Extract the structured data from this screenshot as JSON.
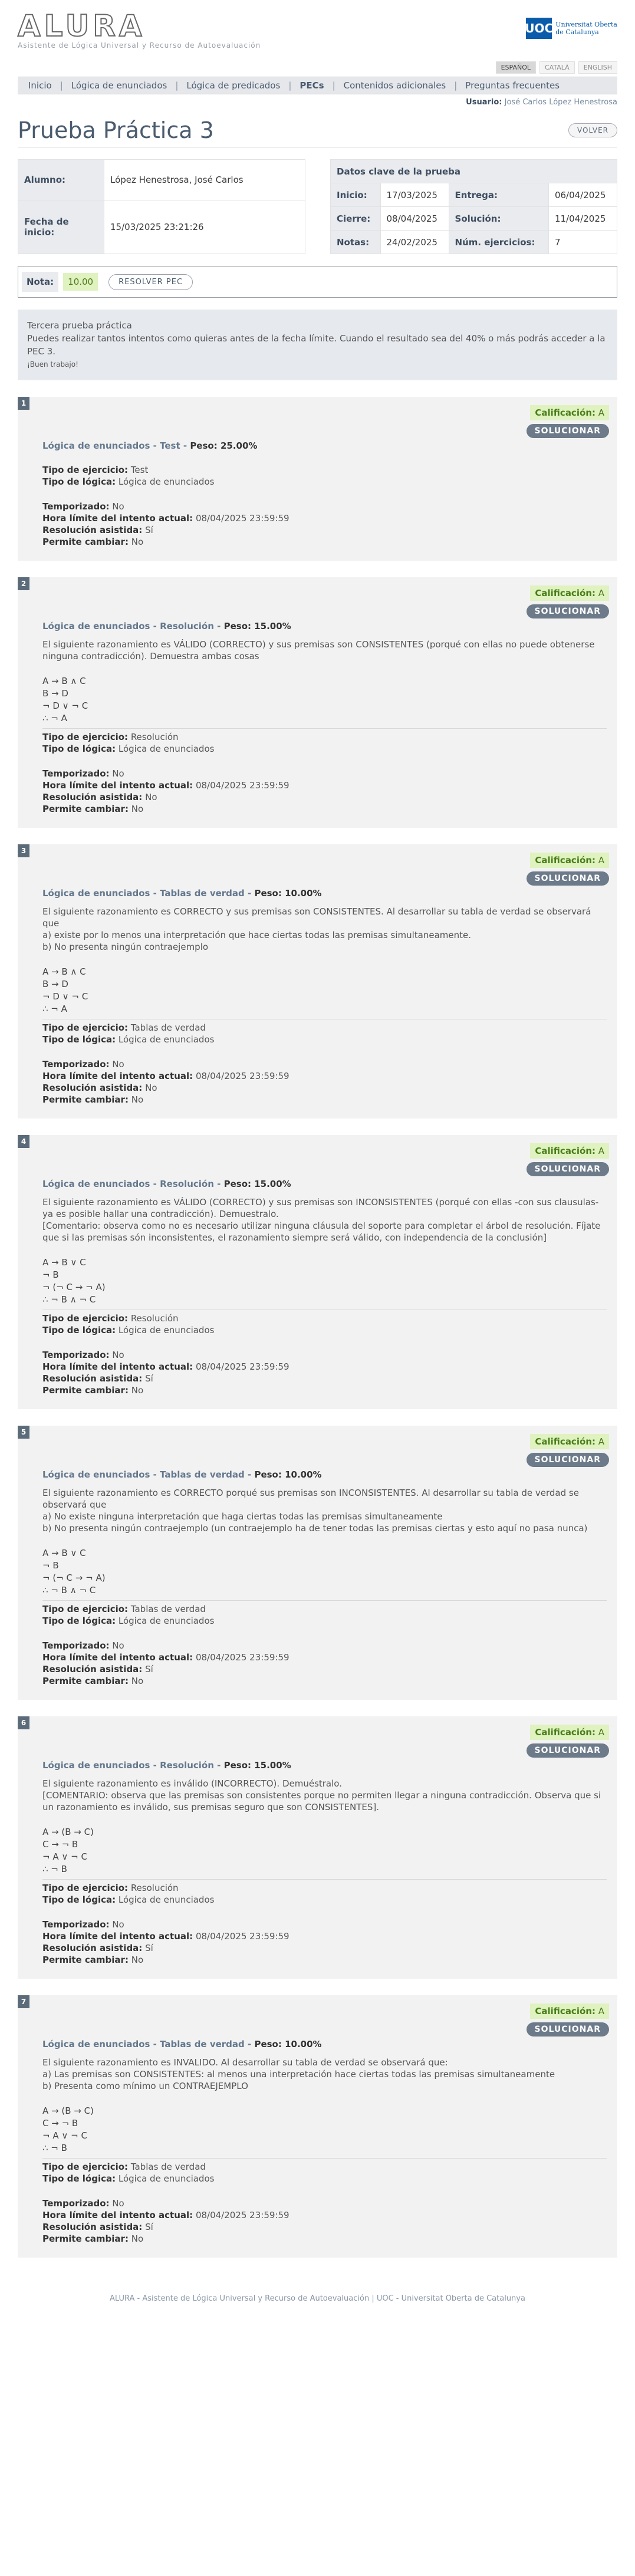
{
  "header": {
    "logo_word": "ALURA",
    "logo_sub": "Asistente de Lógica Universal y Recurso de Autoevaluación",
    "uoc_mark": "UOC",
    "uoc_text_1": "Universitat Oberta",
    "uoc_text_2": "de Catalunya",
    "languages": [
      "ESPAÑOL",
      "CATALÀ",
      "ENGLISH"
    ]
  },
  "nav": {
    "items": [
      "Inicio",
      "Lógica de enunciados",
      "Lógica de predicados",
      "PECs",
      "Contenidos adicionales",
      "Preguntas frecuentes"
    ],
    "active": "PECs"
  },
  "user": {
    "label": "Usuario:",
    "name": "José Carlos López Henestrosa"
  },
  "page": {
    "title": "Prueba Práctica 3",
    "back_button": "VOLVER"
  },
  "student": {
    "alumno_label": "Alumno:",
    "alumno": "López Henestrosa, José Carlos",
    "inicio_label": "Fecha de inicio:",
    "inicio": "15/03/2025 23:21:26"
  },
  "key_data": {
    "title": "Datos clave de la prueba",
    "inicio_label": "Inicio:",
    "inicio": "17/03/2025",
    "entrega_label": "Entrega:",
    "entrega": "06/04/2025",
    "cierre_label": "Cierre:",
    "cierre": "08/04/2025",
    "solucion_label": "Solución:",
    "solucion": "11/04/2025",
    "notas_label": "Notas:",
    "notas": "24/02/2025",
    "num_label": "Núm. ejercicios:",
    "num": "7"
  },
  "grade": {
    "label": "Nota:",
    "value": "10.00",
    "resolve_button": "RESOLVER PEC"
  },
  "description": {
    "line1": "Tercera prueba práctica",
    "line2": "Puedes realizar tantos intentos como quieras antes de la fecha límite. Cuando el resultado sea del 40% o más podrás acceder a la PEC 3.",
    "line3": "¡Buen trabajo!"
  },
  "labels": {
    "calificacion": "Calificación:",
    "solucionar": "SOLUCIONAR",
    "tipo_ejercicio": "Tipo de ejercicio:",
    "tipo_logica": "Tipo de lógica:",
    "temporizado": "Temporizado:",
    "hora_limite": "Hora límite del intento actual:",
    "resolucion": "Resolución asistida:",
    "permite": "Permite cambiar:",
    "peso": "Peso:"
  },
  "exercises": [
    {
      "num": "1",
      "grade": "A",
      "area": "Lógica de enunciados",
      "kind": "Test",
      "peso": "25.00%",
      "statement": [],
      "premises": [],
      "tipo_ejercicio": "Test",
      "tipo_logica": "Lógica de enunciados",
      "temporizado": "No",
      "hora_limite": "08/04/2025 23:59:59",
      "resolucion": "Sí",
      "permite": "No"
    },
    {
      "num": "2",
      "grade": "A",
      "area": "Lógica de enunciados",
      "kind": "Resolución",
      "peso": "15.00%",
      "statement": [
        "El siguiente razonamiento es VÁLIDO (CORRECTO) y sus premisas son CONSISTENTES (porqué con ellas no puede obtenerse ninguna contradicción). Demuestra ambas cosas"
      ],
      "premises": [
        "A → B ∧ C",
        "B → D",
        "¬ D ∨ ¬ C",
        "∴ ¬ A"
      ],
      "tipo_ejercicio": "Resolución",
      "tipo_logica": "Lógica de enunciados",
      "temporizado": "No",
      "hora_limite": "08/04/2025 23:59:59",
      "resolucion": "No",
      "permite": "No"
    },
    {
      "num": "3",
      "grade": "A",
      "area": "Lógica de enunciados",
      "kind": "Tablas de verdad",
      "peso": "10.00%",
      "statement": [
        "El siguiente razonamiento es CORRECTO y sus premisas son CONSISTENTES. Al desarrollar su tabla de verdad se observará que",
        "a) existe por lo menos una interpretación que hace ciertas todas las premisas simultaneamente.",
        "b) No presenta ningún contraejemplo"
      ],
      "premises": [
        "A → B ∧ C",
        "B → D",
        "¬ D ∨ ¬ C",
        "∴ ¬ A"
      ],
      "tipo_ejercicio": "Tablas de verdad",
      "tipo_logica": "Lógica de enunciados",
      "temporizado": "No",
      "hora_limite": "08/04/2025 23:59:59",
      "resolucion": "No",
      "permite": "No"
    },
    {
      "num": "4",
      "grade": "A",
      "area": "Lógica de enunciados",
      "kind": "Resolución",
      "peso": "15.00%",
      "statement": [
        "El siguiente razonamiento es VÁLIDO (CORRECTO) y sus premisas son INCONSISTENTES  (porqué con ellas -con sus clausulas- ya es posible hallar una contradicción). Demuestralo.",
        "[Comentario: observa como no es necesario utilizar ninguna cláusula del soporte para completar el árbol de resolución. Fíjate que si las premisas són inconsistentes, el razonamiento siempre será válido, con independencia de la conclusión]"
      ],
      "premises": [
        "A → B ∨ C",
        "¬ B",
        "¬ (¬ C → ¬ A)",
        "∴ ¬ B ∧ ¬ C"
      ],
      "tipo_ejercicio": "Resolución",
      "tipo_logica": "Lógica de enunciados",
      "temporizado": "No",
      "hora_limite": "08/04/2025 23:59:59",
      "resolucion": "Sí",
      "permite": "No"
    },
    {
      "num": "5",
      "grade": "A",
      "area": "Lógica de enunciados",
      "kind": "Tablas de verdad",
      "peso": "10.00%",
      "statement": [
        "El siguiente razonamiento es CORRECTO porqué sus premisas son INCONSISTENTES. Al desarrollar su tabla de verdad se observará que",
        "a) No existe ninguna interpretación que haga ciertas todas las premisas simultaneamente",
        "b) No presenta ningún contraejemplo (un contraejemplo ha de tener todas las premisas ciertas y esto aquí no pasa nunca)"
      ],
      "premises": [
        "A → B ∨ C",
        "¬ B",
        "¬ (¬ C → ¬ A)",
        "∴ ¬ B ∧ ¬ C"
      ],
      "tipo_ejercicio": "Tablas de verdad",
      "tipo_logica": "Lógica de enunciados",
      "temporizado": "No",
      "hora_limite": "08/04/2025 23:59:59",
      "resolucion": "Sí",
      "permite": "No"
    },
    {
      "num": "6",
      "grade": "A",
      "area": "Lógica de enunciados",
      "kind": "Resolución",
      "peso": "15.00%",
      "statement": [
        "El siguiente razonamiento es inválido (INCORRECTO). Demuéstralo.",
        "[COMENTARIO: observa que las premisas son consistentes porque no permiten llegar a ninguna contradicción. Observa que si un razonamiento es inválido, sus premisas seguro que son CONSISTENTES]."
      ],
      "premises": [
        "A → (B → C)",
        "C → ¬ B",
        "¬ A ∨ ¬ C",
        "∴ ¬ B"
      ],
      "tipo_ejercicio": "Resolución",
      "tipo_logica": "Lógica de enunciados",
      "temporizado": "No",
      "hora_limite": "08/04/2025 23:59:59",
      "resolucion": "Sí",
      "permite": "No"
    },
    {
      "num": "7",
      "grade": "A",
      "area": "Lógica de enunciados",
      "kind": "Tablas de verdad",
      "peso": "10.00%",
      "statement": [
        "El siguiente razonamiento es INVALIDO. Al desarrollar su tabla de verdad se observará que:",
        "a) Las premisas son CONSISTENTES:  al menos una interpretación hace ciertas todas las premisas simultaneamente",
        "b) Presenta como  mínimo un CONTRAEJEMPLO"
      ],
      "premises": [
        "A → (B → C)",
        "C → ¬ B",
        "¬ A ∨ ¬ C",
        "∴ ¬ B"
      ],
      "tipo_ejercicio": "Tablas de verdad",
      "tipo_logica": "Lógica de enunciados",
      "temporizado": "No",
      "hora_limite": "08/04/2025 23:59:59",
      "resolucion": "Sí",
      "permite": "No"
    }
  ],
  "footer": "ALURA - Asistente de Lógica Universal y Recurso de Autoevaluación  |  UOC - Universitat Oberta de Catalunya"
}
